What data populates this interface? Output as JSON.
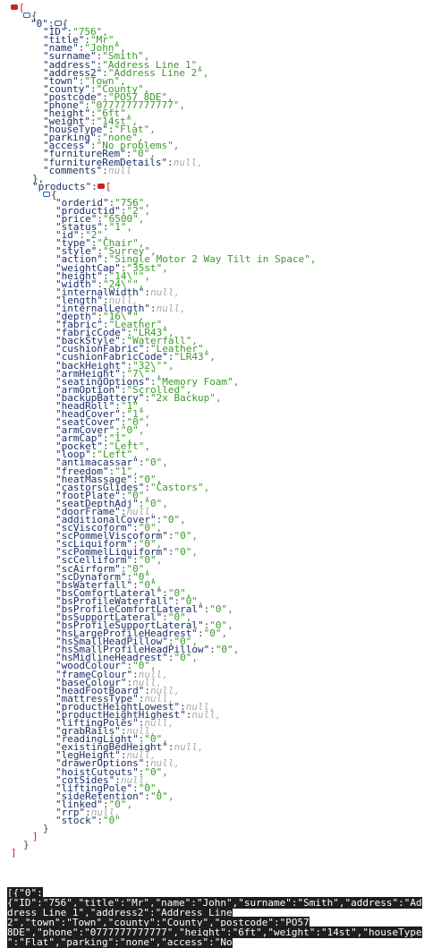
{
  "viewer": {
    "root_open": "[",
    "root_close": "]",
    "item_index": "\"0\":",
    "products_key": "\"products\":",
    "rows": [
      {
        "k": "\"ID\"",
        "v": "\"756\","
      },
      {
        "k": "\"title\"",
        "v": "\"Mr\","
      },
      {
        "k": "\"name\"",
        "v": "\"John\","
      },
      {
        "k": "\"surname\"",
        "v": "\"Smith\","
      },
      {
        "k": "\"address\"",
        "v": "\"Address Line 1\","
      },
      {
        "k": "\"address2\"",
        "v": "\"Address Line 2\","
      },
      {
        "k": "\"town\"",
        "v": "\"Town\","
      },
      {
        "k": "\"county\"",
        "v": "\"County\","
      },
      {
        "k": "\"postcode\"",
        "v": "\"PO57 8DE\","
      },
      {
        "k": "\"phone\"",
        "v": "\"0777777777777\","
      },
      {
        "k": "\"height\"",
        "v": "\"6ft\","
      },
      {
        "k": "\"weight\"",
        "v": "\"14st\","
      },
      {
        "k": "\"houseType\"",
        "v": "\"Flat\","
      },
      {
        "k": "\"parking\"",
        "v": "\"none\","
      },
      {
        "k": "\"access\"",
        "v": "\"No problems\","
      },
      {
        "k": "\"furnitureRem\"",
        "v": "\"0\","
      },
      {
        "k": "\"furnitureRemDetails\"",
        "v": "null,"
      },
      {
        "k": "\"comments\"",
        "v": "null"
      }
    ],
    "product_rows": [
      {
        "k": "\"orderid\"",
        "v": "\"756\","
      },
      {
        "k": "\"productid\"",
        "v": "\"2\","
      },
      {
        "k": "\"price\"",
        "v": "\"6500\","
      },
      {
        "k": "\"status\"",
        "v": "\"1\","
      },
      {
        "k": "\"id\"",
        "v": "\"2\","
      },
      {
        "k": "\"type\"",
        "v": "\"Chair\","
      },
      {
        "k": "\"style\"",
        "v": "\"Surrey\","
      },
      {
        "k": "\"action\"",
        "v": "\"Single Motor 2 Way Tilt in Space\","
      },
      {
        "k": "\"weightCap\"",
        "v": "\"35st\","
      },
      {
        "k": "\"height\"",
        "v": "\"14\\\"\","
      },
      {
        "k": "\"width\"",
        "v": "\"24\\\"\","
      },
      {
        "k": "\"internalWidth\"",
        "v": "null,"
      },
      {
        "k": "\"length\"",
        "v": "null,"
      },
      {
        "k": "\"internalLength\"",
        "v": "null,"
      },
      {
        "k": "\"depth\"",
        "v": "\"16\\\"\","
      },
      {
        "k": "\"fabric\"",
        "v": "\"Leather\","
      },
      {
        "k": "\"fabricCode\"",
        "v": "\"LR43\","
      },
      {
        "k": "\"backStyle\"",
        "v": "\"Waterfall\","
      },
      {
        "k": "\"cushionFabric\"",
        "v": "\"Leather\","
      },
      {
        "k": "\"cushionFabricCode\"",
        "v": "\"LR43\","
      },
      {
        "k": "\"backHeight\"",
        "v": "\"32\\\"\","
      },
      {
        "k": "\"armHeight\"",
        "v": "\"7\\\"\","
      },
      {
        "k": "\"seatingOptions\"",
        "v": "\"Memory Foam\","
      },
      {
        "k": "\"armOption\"",
        "v": "\"Scrolled\","
      },
      {
        "k": "\"backupBattery\"",
        "v": "\"2x Backup\","
      },
      {
        "k": "\"headRoll\"",
        "v": "\"1\","
      },
      {
        "k": "\"headCover\"",
        "v": "\"1\","
      },
      {
        "k": "\"seatCover\"",
        "v": "\"0\","
      },
      {
        "k": "\"armCover\"",
        "v": "\"0\","
      },
      {
        "k": "\"armCap\"",
        "v": "\"1\","
      },
      {
        "k": "\"pocket\"",
        "v": "\"Left\","
      },
      {
        "k": "\"loop\"",
        "v": "\"Left\","
      },
      {
        "k": "\"antimacassar\"",
        "v": "\"0\","
      },
      {
        "k": "\"freedom\"",
        "v": "\"1\","
      },
      {
        "k": "\"heatMassage\"",
        "v": "\"0\","
      },
      {
        "k": "\"castorsGlides\"",
        "v": "\"Castors\","
      },
      {
        "k": "\"footPlate\"",
        "v": "\"0\","
      },
      {
        "k": "\"seatDepthAdj\"",
        "v": "\"0\","
      },
      {
        "k": "\"doorFrame\"",
        "v": "null,"
      },
      {
        "k": "\"additionalCover\"",
        "v": "\"0\","
      },
      {
        "k": "\"scViscoform\"",
        "v": "\"0\","
      },
      {
        "k": "\"scPommelViscoform\"",
        "v": "\"0\","
      },
      {
        "k": "\"scLiquiform\"",
        "v": "\"0\","
      },
      {
        "k": "\"scPommelLiquiform\"",
        "v": "\"0\","
      },
      {
        "k": "\"scCelliform\"",
        "v": "\"0\","
      },
      {
        "k": "\"scAirform\"",
        "v": "\"0\","
      },
      {
        "k": "\"scDynaform\"",
        "v": "\"0\","
      },
      {
        "k": "\"bsWaterfall\"",
        "v": "\"0\","
      },
      {
        "k": "\"bsComfortLateral\"",
        "v": "\"0\","
      },
      {
        "k": "\"bsProfileWaterfall\"",
        "v": "\"0\","
      },
      {
        "k": "\"bsProfileComfortLateral\"",
        "v": "\"0\","
      },
      {
        "k": "\"bsSupportLateral\"",
        "v": "\"0\","
      },
      {
        "k": "\"bsProfileSupportLateral\"",
        "v": "\"0\","
      },
      {
        "k": "\"hsLargeProfileHeadrest\"",
        "v": "\"0\","
      },
      {
        "k": "\"hsSmallHeadPillow\"",
        "v": "\"0\","
      },
      {
        "k": "\"hsSmallProfileHeadPillow\"",
        "v": "\"0\","
      },
      {
        "k": "\"hsMidlineHeadrest\"",
        "v": "\"0\","
      },
      {
        "k": "\"woodColour\"",
        "v": "\"0\","
      },
      {
        "k": "\"frameColour\"",
        "v": "null,"
      },
      {
        "k": "\"baseColour\"",
        "v": "null,"
      },
      {
        "k": "\"headFootBoard\"",
        "v": "null,"
      },
      {
        "k": "\"mattressType\"",
        "v": "null,"
      },
      {
        "k": "\"productHeightLowest\"",
        "v": "null,"
      },
      {
        "k": "\"productHeightHighest\"",
        "v": "null,"
      },
      {
        "k": "\"liftingPoles\"",
        "v": "null,"
      },
      {
        "k": "\"grabRails\"",
        "v": "null,"
      },
      {
        "k": "\"readingLight\"",
        "v": "\"0\","
      },
      {
        "k": "\"existingBedHeight\"",
        "v": "null,"
      },
      {
        "k": "\"legHeight\"",
        "v": "null,"
      },
      {
        "k": "\"drawerOptions\"",
        "v": "null,"
      },
      {
        "k": "\"hoistCutouts\"",
        "v": "\"0\","
      },
      {
        "k": "\"cotSides\"",
        "v": "null,"
      },
      {
        "k": "\"liftingPole\"",
        "v": "\"0\","
      },
      {
        "k": "\"sideRetention\"",
        "v": "\"0\","
      },
      {
        "k": "\"linked\"",
        "v": "\"0\","
      },
      {
        "k": "\"rrp\"",
        "v": "null,"
      },
      {
        "k": "\"stock\"",
        "v": "\"0\""
      }
    ]
  },
  "raw": {
    "lines": [
      "[{\"0\":",
      "{\"ID\":\"756\",\"title\":\"Mr\",\"name\":\"John\",\"surname\":\"Smith\",\"address\":\"Ad",
      "dress Line 1\",\"address2\":\"Address Line",
      "2\",\"town\":\"Town\",\"county\":\"County\",\"postcode\":\"PO57",
      "8DE\",\"phone\":\"0777777777777\",\"height\":\"6ft\",\"weight\":\"14st\",\"houseType",
      "\":\"Flat\",\"parking\":\"none\",\"access\":\"No"
    ]
  },
  "colors": {
    "key": "#1b2f6b",
    "string": "#3a9a2a",
    "null": "#a9a9a9",
    "toggle": "#d02020",
    "highlight": "#1e1e1e"
  }
}
